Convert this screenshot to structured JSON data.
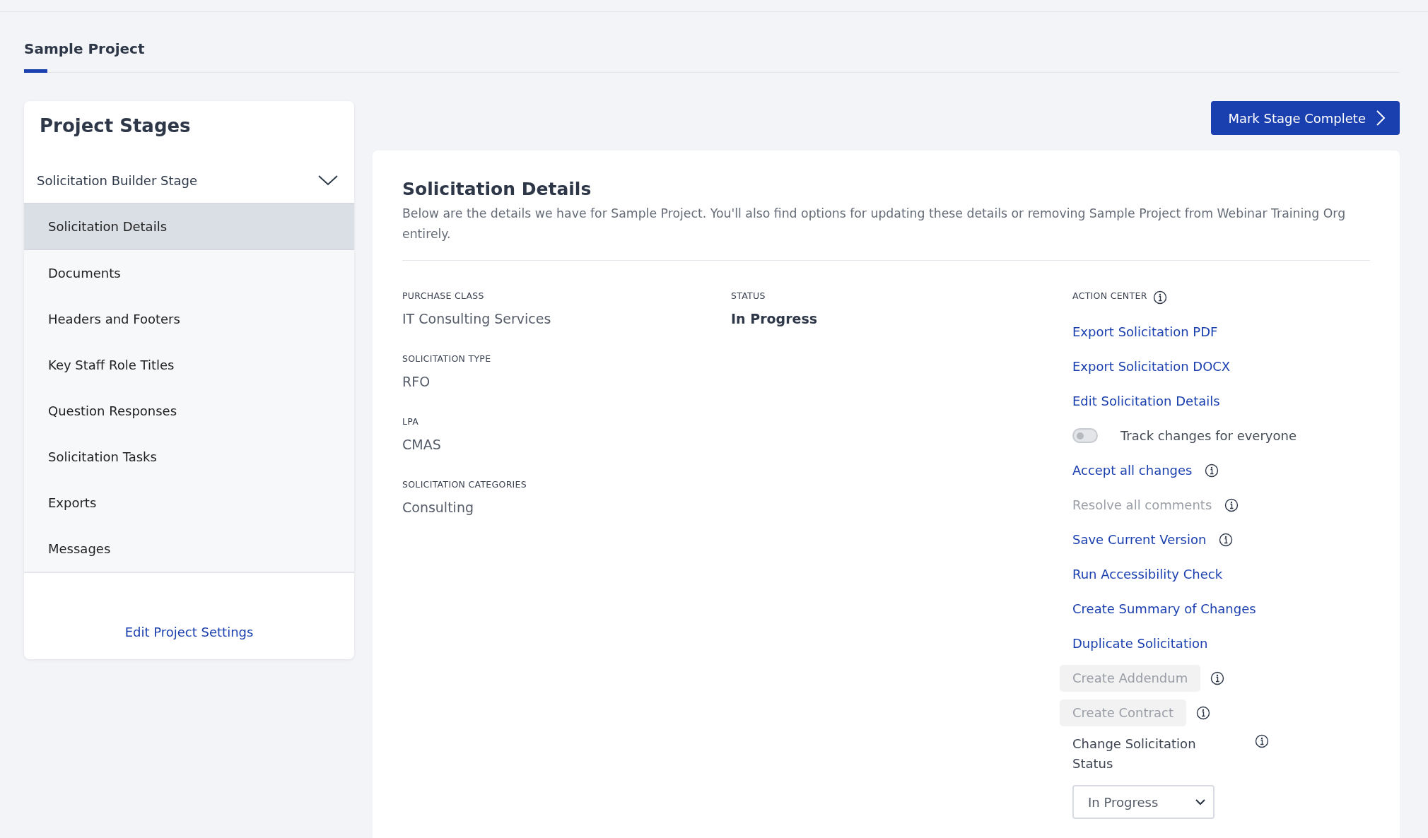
{
  "project_tab": {
    "label": "Sample Project",
    "selected": true
  },
  "sidebar": {
    "title": "Project Stages",
    "stage": {
      "label": "Solicitation Builder Stage",
      "expanded": true
    },
    "items": [
      {
        "label": "Solicitation Details",
        "selected": true
      },
      {
        "label": "Documents",
        "selected": false
      },
      {
        "label": "Headers and Footers",
        "selected": false
      },
      {
        "label": "Key Staff Role Titles",
        "selected": false
      },
      {
        "label": "Question Responses",
        "selected": false
      },
      {
        "label": "Solicitation Tasks",
        "selected": false
      },
      {
        "label": "Exports",
        "selected": false
      },
      {
        "label": "Messages",
        "selected": false
      }
    ],
    "footer_link": "Edit Project Settings"
  },
  "primary_button": "Mark Stage Complete",
  "details": {
    "title": "Solicitation Details",
    "description": "Below are the details we have for Sample Project. You'll also find options for updating these details or removing Sample Project from Webinar Training Org entirely.",
    "fields": [
      {
        "label": "PURCHASE CLASS",
        "value": "IT Consulting Services"
      },
      {
        "label": "SOLICITATION TYPE",
        "value": "RFO"
      },
      {
        "label": "LPA",
        "value": "CMAS"
      },
      {
        "label": "SOLICITATION CATEGORIES",
        "value": "Consulting"
      }
    ],
    "status": {
      "label": "STATUS",
      "value": "In Progress"
    },
    "action_center": {
      "title": "ACTION CENTER",
      "info": true,
      "items": [
        {
          "kind": "link",
          "label": "Export Solicitation PDF",
          "disabled": false,
          "info": false
        },
        {
          "kind": "link",
          "label": "Export Solicitation DOCX",
          "disabled": false,
          "info": false
        },
        {
          "kind": "link",
          "label": "Edit Solicitation Details",
          "disabled": false,
          "info": false
        },
        {
          "kind": "toggle",
          "label": "Track changes for everyone",
          "on": false
        },
        {
          "kind": "link",
          "label": "Accept all changes",
          "disabled": false,
          "info": true
        },
        {
          "kind": "link",
          "label": "Resolve all comments",
          "disabled": true,
          "info": true
        },
        {
          "kind": "link",
          "label": "Save Current Version",
          "disabled": false,
          "info": true
        },
        {
          "kind": "link",
          "label": "Run Accessibility Check",
          "disabled": false,
          "info": false
        },
        {
          "kind": "link",
          "label": "Create Summary of Changes",
          "disabled": false,
          "info": false
        },
        {
          "kind": "link",
          "label": "Duplicate Solicitation",
          "disabled": false,
          "info": false
        },
        {
          "kind": "button",
          "label": "Create Addendum",
          "disabled": true,
          "info": true
        },
        {
          "kind": "button",
          "label": "Create Contract",
          "disabled": true,
          "info": true
        }
      ],
      "status_select": {
        "label": "Change Solicitation Status",
        "value": "In Progress",
        "info": true
      }
    }
  }
}
